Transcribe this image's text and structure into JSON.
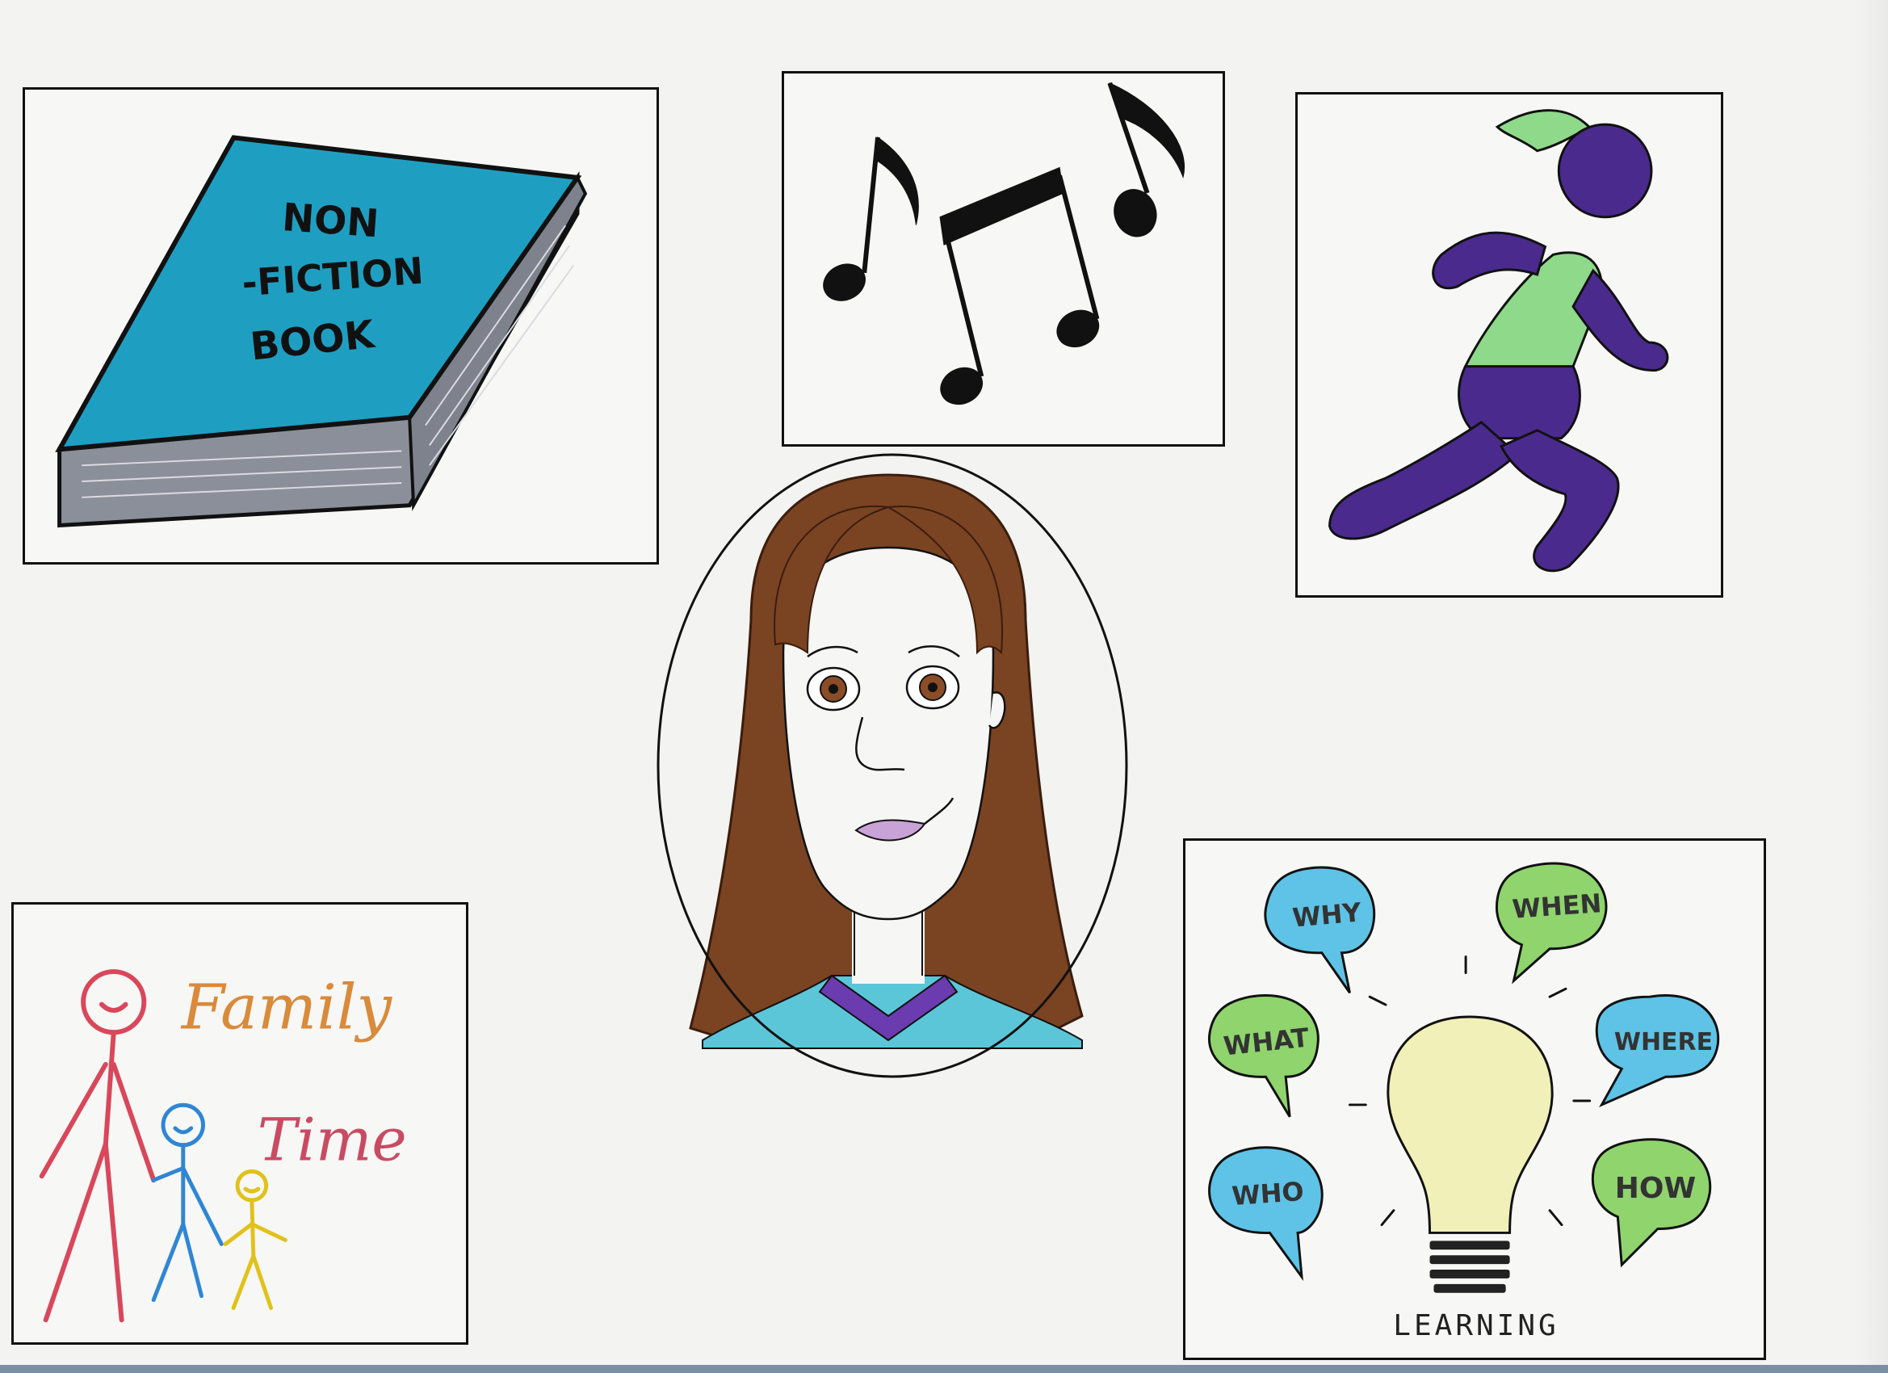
{
  "book": {
    "title_line1": "NON",
    "title_line2": "-FICTION",
    "title_line3": "BOOK"
  },
  "family": {
    "word1": "Family",
    "word2": "Time"
  },
  "learning": {
    "bubbles": [
      "WHY",
      "WHEN",
      "WHAT",
      "WHERE",
      "WHO",
      "HOW"
    ],
    "caption": "LEARNING"
  },
  "colors": {
    "book_cover": "#1e9fc2",
    "book_pages": "#8b8f99",
    "runner_body": "#4a2a8c",
    "runner_shirt": "#8fd98a",
    "hair": "#7a4322",
    "shirt": "#5cc6d9",
    "bulb": "#f1f0b8",
    "bubble_blue": "#5ec3e6",
    "bubble_green": "#8fd46d"
  }
}
